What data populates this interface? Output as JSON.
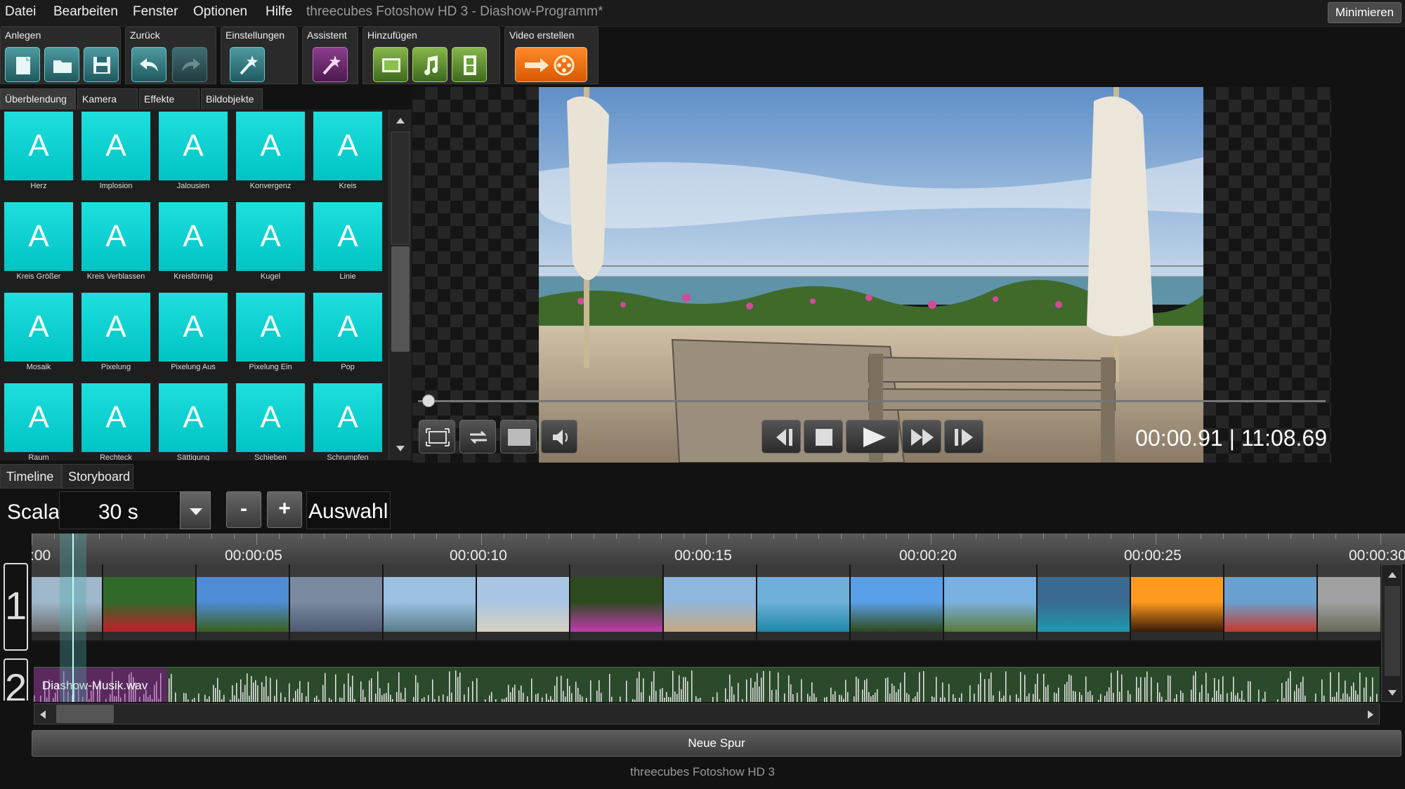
{
  "menu": [
    "Datei",
    "Bearbeiten",
    "Fenster",
    "Optionen",
    "Hilfe"
  ],
  "window": {
    "title": "threecubes Fotoshow HD 3 - Diashow-Programm*",
    "minimize_label": "Minimieren"
  },
  "toolbar": {
    "groups": [
      "Anlegen",
      "Zurück",
      "Einstellungen",
      "Assistent",
      "Hinzufügen",
      "Video erstellen"
    ]
  },
  "effect_tabs": [
    "Überblendung",
    "Kamera",
    "Effekte",
    "Bildobjekte"
  ],
  "transitions": {
    "tile_glyph": "A",
    "tile_color": "#00d2d2",
    "items": [
      "Herz",
      "Implosion",
      "Jalousien",
      "Konvergenz",
      "Kreis",
      "Kreis Größer",
      "Kreis Verblassen",
      "Kreisförmig",
      "Kugel",
      "Linie",
      "Mosaik",
      "Pixelung",
      "Pixelung Aus",
      "Pixelung Ein",
      "Pop",
      "Raum",
      "Rechteck",
      "Sättigung",
      "Schieben",
      "Schrumpfen"
    ]
  },
  "preview": {
    "current_time": "00:00.91",
    "separator": "|",
    "total_time": "11:08.69",
    "progress": 0.001
  },
  "timeline": {
    "tabs": [
      "Timeline",
      "Storyboard"
    ],
    "scale_label": "Scala",
    "scale_value": "30 s",
    "zoom_out": "-",
    "zoom_in": "+",
    "selection_label": "Auswahl",
    "ruler_labels": [
      ":00",
      "00:00:05",
      "00:00:10",
      "00:00:15",
      "00:00:20",
      "00:00:25",
      "00:00:30"
    ],
    "track1_number": "1",
    "track2_number": "2",
    "clip_themes": [
      "bench",
      "roses",
      "palm",
      "pyramid",
      "beach",
      "arch",
      "flowers",
      "bay",
      "boats",
      "palm2",
      "tree",
      "coast",
      "sunset",
      "poppies",
      "ruins"
    ],
    "audio_file": "Diashow-Musik.wav",
    "audio_color": "#2b4a2b",
    "new_track_label": "Neue Spur"
  },
  "status_bar": "threecubes Fotoshow HD 3"
}
